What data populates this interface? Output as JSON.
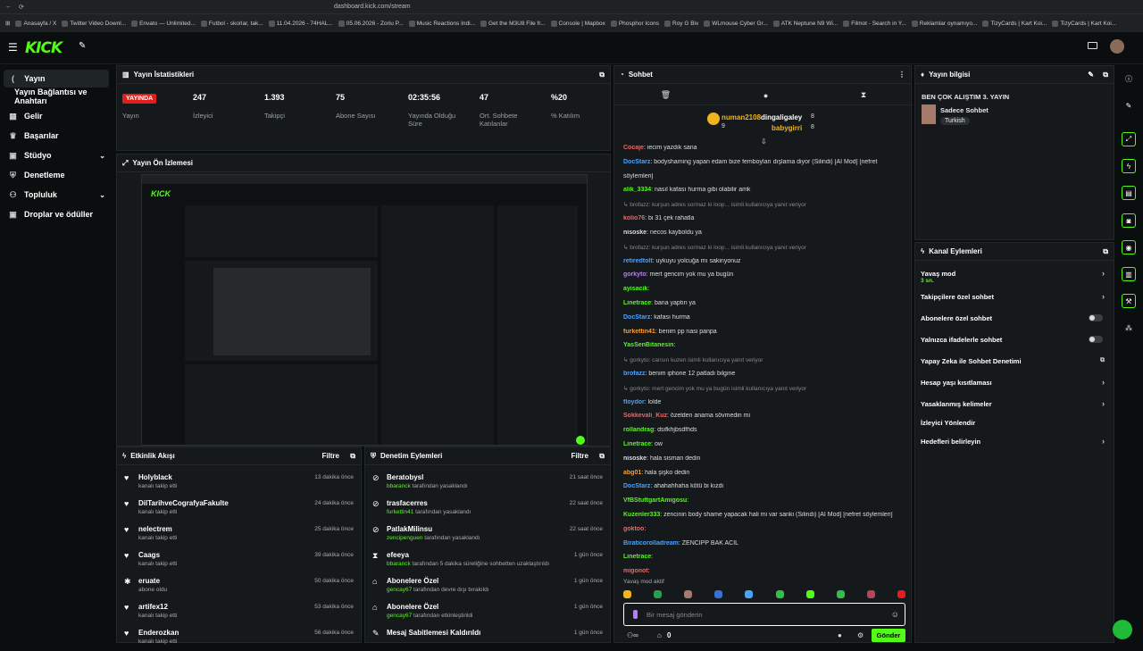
{
  "browser": {
    "url": "dashboard.kick.com/stream",
    "bookmarks": [
      "Anasayfa / X",
      "Twitter Video Downl...",
      "Envato — Unlimited...",
      "Futbol - skorlar, tak...",
      "11.04.2026 - 74HAL...",
      "05.06.2026 - Zoriu P...",
      "Music Reactions Indi...",
      "Get the M3U8 File fr...",
      "Console | Mapbox",
      "Phosphor Icons",
      "Roy G Biv",
      "WLmouse Cyber Gr...",
      "ATK Neptune N9 Wi...",
      "Filmot - Search in Y...",
      "Reklamlar oynamıyo...",
      "TizyCards | Kart Koi...",
      "TizyCards | Kart Koi..."
    ]
  },
  "logo": "KICK",
  "sidebar": [
    {
      "label": "Yayın",
      "icon": "broadcast-icon"
    },
    {
      "label": "Yayın Bağlantısı ve Anahtarı",
      "icon": ""
    },
    {
      "label": "Gelir",
      "icon": "grid-icon"
    },
    {
      "label": "Başarılar",
      "icon": "trophy-icon"
    },
    {
      "label": "Stüdyo",
      "icon": "studio-icon"
    },
    {
      "label": "Denetleme",
      "icon": "shield-icon"
    },
    {
      "label": "Topluluk",
      "icon": "people-icon"
    },
    {
      "label": "Droplar ve ödüller",
      "icon": "gift-icon"
    }
  ],
  "stats": {
    "title": "Yayın İstatistikleri",
    "live": "YAYINDA",
    "live_label": "Yayın",
    "items": [
      {
        "v": "247",
        "l": "İzleyici"
      },
      {
        "v": "1.393",
        "l": "Takipçi"
      },
      {
        "v": "75",
        "l": "Abone Sayısı"
      },
      {
        "v": "02:35:56",
        "l": "Yayında Olduğu Süre"
      },
      {
        "v": "47",
        "l": "Ort. Sohbete Katılanlar"
      },
      {
        "v": "%20",
        "l": "% Katılım"
      }
    ]
  },
  "preview": {
    "title": "Yayın Ön İzlemesi"
  },
  "activity": {
    "title": "Etkinlik Akışı",
    "filter": "Filtre",
    "rows": [
      {
        "n": "Holyblack",
        "s": "kanalı takip etti",
        "t": "13 dakika önce",
        "icon": "heart-icon"
      },
      {
        "n": "DilTarihveCografyaFakulte",
        "s": "kanalı takip etti",
        "t": "24 dakika önce",
        "icon": "heart-icon"
      },
      {
        "n": "nelectrem",
        "s": "kanalı takip etti",
        "t": "25 dakika önce",
        "icon": "heart-icon"
      },
      {
        "n": "Caags",
        "s": "kanalı takip etti",
        "t": "39 dakika önce",
        "icon": "heart-icon"
      },
      {
        "n": "eruate",
        "s": "abone oldu",
        "t": "50 dakika önce",
        "icon": "star-icon"
      },
      {
        "n": "artifex12",
        "s": "kanalı takip etti",
        "t": "53 dakika önce",
        "icon": "heart-icon"
      },
      {
        "n": "Enderozkan",
        "s": "kanalı takip etti",
        "t": "56 dakika önce",
        "icon": "heart-icon"
      }
    ]
  },
  "moderation": {
    "title": "Denetim Eylemleri",
    "filter": "Filtre",
    "rows": [
      {
        "n": "Beratobysl",
        "u": "bbaranck",
        "s": " tarafından yasaklandı",
        "t": "21 saat önce",
        "icon": "ban-icon"
      },
      {
        "n": "trasfacerres",
        "u": "furkettin41",
        "s": " tarafından yasaklandı",
        "t": "22 saat önce",
        "icon": "ban-icon"
      },
      {
        "n": "PatlakMilinsu",
        "u": "zencipenguen",
        "s": " tarafından yasaklandı",
        "t": "22 saat önce",
        "icon": "ban-icon"
      },
      {
        "n": "efeeya",
        "u": "bbaranck",
        "s": " tarafından 5 dakika süreliğine sohbetten uzaklaştırıldı",
        "t": "1 gün önce",
        "icon": "hourglass-icon"
      },
      {
        "n": "Abonelere Özel",
        "u": "gencay67",
        "s": " tarafından devre dışı bırakıldı",
        "t": "1 gün önce",
        "icon": "building-icon"
      },
      {
        "n": "Abonelere Özel",
        "u": "gencay67",
        "s": " tarafından etkinleştirildi",
        "t": "1 gün önce",
        "icon": "building-icon"
      },
      {
        "n": "Mesaj Sabitlemesi Kaldırıldı",
        "u": "",
        "s": "",
        "t": "1 gün önce",
        "icon": "pin-icon"
      }
    ]
  },
  "chat": {
    "title": "Sohbet",
    "top": [
      {
        "n": "numan2108",
        "c": "9"
      },
      {
        "n": "dingaligaley",
        "c": "8"
      },
      {
        "n": "babygirri",
        "c": "8"
      }
    ],
    "lines": [
      {
        "u": "Cocaje",
        "m": ": iecim yazdık sana",
        "c": "#e66"
      },
      {
        "u": "DocStarz",
        "m": ": bodyshaming yapan edam bize femboyları dışlama diyor (Silindi) [AI Mod] [nefret",
        "c": "#4aa3ff"
      },
      {
        "u": "",
        "m": "söylemleri]",
        "c": "#fff"
      },
      {
        "u": "alik_3334",
        "m": ": nasıl kafası hurma gibi olabilir amk",
        "c": "#53fc18"
      },
      {
        "u": "",
        "m": "↳ brofazz: kurşun adres sormaz ki loop... isimli kullanıcıya yanıt veriyor",
        "c": "#888",
        "sys": true
      },
      {
        "u": "kolio76",
        "m": ": bi 31 çek rahatla",
        "c": "#e66"
      },
      {
        "u": "nisoske",
        "m": ": necos kayboldu ya",
        "c": "#ddd"
      },
      {
        "u": "",
        "m": "↳ brofazz: kurşun adres sormaz ki loop... isimli kullanıcıya yanıt veriyor",
        "c": "#888",
        "sys": true
      },
      {
        "u": "retiredtolt",
        "m": ": uykuyu yolcuğa mı sakinyonuz",
        "c": "#4aa3ff"
      },
      {
        "u": "gorkyto",
        "m": ": mert gencim yok mu ya bugün",
        "c": "#b97bff"
      },
      {
        "u": "ayisacik",
        "m": ":",
        "c": "#53fc18"
      },
      {
        "u": "Linetrace",
        "m": ": bana yaptın ya",
        "c": "#53fc18"
      },
      {
        "u": "DocStarz",
        "m": ": kafası hurma",
        "c": "#4aa3ff"
      },
      {
        "u": "furkettin41",
        "m": ": benim pp nasi panpa",
        "c": "#ff9d2e"
      },
      {
        "u": "YasSenBitanesin",
        "m": ":",
        "c": "#53fc18"
      },
      {
        "u": "",
        "m": "↳ gorkyto: cansın kuzen isimli kullanıcıya yanıt veriyor",
        "c": "#888",
        "sys": true
      },
      {
        "u": "brofazz",
        "m": ": benim iphone 12 patladı bilgine",
        "c": "#4aa3ff"
      },
      {
        "u": "",
        "m": "↳ gorkyto: mert gencim yok mu ya bugün isimli kullanıcıya yanıt veriyor",
        "c": "#888",
        "sys": true
      },
      {
        "u": "floydor",
        "m": ": lolde",
        "c": "#4aa3ff"
      },
      {
        "u": "Sokkevali_Kuz",
        "m": ": özelden anama sövmedin mi",
        "c": "#e66"
      },
      {
        "u": "rollandrag",
        "m": ": dsifkhjbsdfhds",
        "c": "#53fc18"
      },
      {
        "u": "Linetrace",
        "m": ": ow",
        "c": "#53fc18"
      },
      {
        "u": "nisoske",
        "m": ": hala sisman dedin",
        "c": "#ddd"
      },
      {
        "u": "abg01",
        "m": ": hala şişko dedin",
        "c": "#ff9d2e"
      },
      {
        "u": "DocStarz",
        "m": ": ahahahhaha kötü bi kızdı",
        "c": "#4aa3ff"
      },
      {
        "u": "VfBStuttgartAmigosu",
        "m": ":",
        "c": "#53fc18"
      },
      {
        "u": "Kuzenler333",
        "m": ": zencinin body shame yapacak hali mi var sanki (Silindi) [AI Mod] [nefret söylemleri]",
        "c": "#53fc18"
      },
      {
        "u": "goktoo",
        "m": ":",
        "c": "#e66"
      },
      {
        "u": "Biraticorolladream",
        "m": ": ZENCİPP BAK ACİL",
        "c": "#4aa3ff"
      },
      {
        "u": "Linetrace",
        "m": ":",
        "c": "#53fc18"
      },
      {
        "u": "migonot",
        "m": ":",
        "c": "#e66"
      }
    ],
    "slow": "Yavaş mod aktif",
    "placeholder": "Bir mesaj gönderin",
    "send": "Gönder",
    "count": "0"
  },
  "info": {
    "title": "Yayın bilgisi",
    "stream_title": "BEN ÇOK ALIŞTIM 3. YAYIN",
    "tag": "Sadece Sohbet",
    "lang": "Turkish"
  },
  "actions": {
    "title": "Kanal Eylemleri",
    "items": [
      {
        "l": "Yavaş mod",
        "s": "3 sn.",
        "type": "arrow"
      },
      {
        "l": "Takipçilere özel sohbet",
        "s": "",
        "type": "arrow"
      },
      {
        "l": "Abonelere özel sohbet",
        "s": "",
        "type": "toggle"
      },
      {
        "l": "Yalnızca ifadelerle sohbet",
        "s": "",
        "type": "toggle"
      },
      {
        "l": "Yapay Zeka ile Sohbet Denetimi",
        "s": "",
        "type": "ext"
      },
      {
        "l": "Hesap yaşı kısıtlaması",
        "s": "",
        "type": "arrow"
      },
      {
        "l": "Yasaklanmış kelimeler",
        "s": "",
        "type": "arrow"
      },
      {
        "l": "İzleyici Yönlendir",
        "s": "",
        "type": "none"
      },
      {
        "l": "Hedefleri belirleyin",
        "s": "",
        "type": "arrow"
      }
    ]
  },
  "colors": {
    "accent": "#53fc18",
    "live": "#e21d1d"
  }
}
